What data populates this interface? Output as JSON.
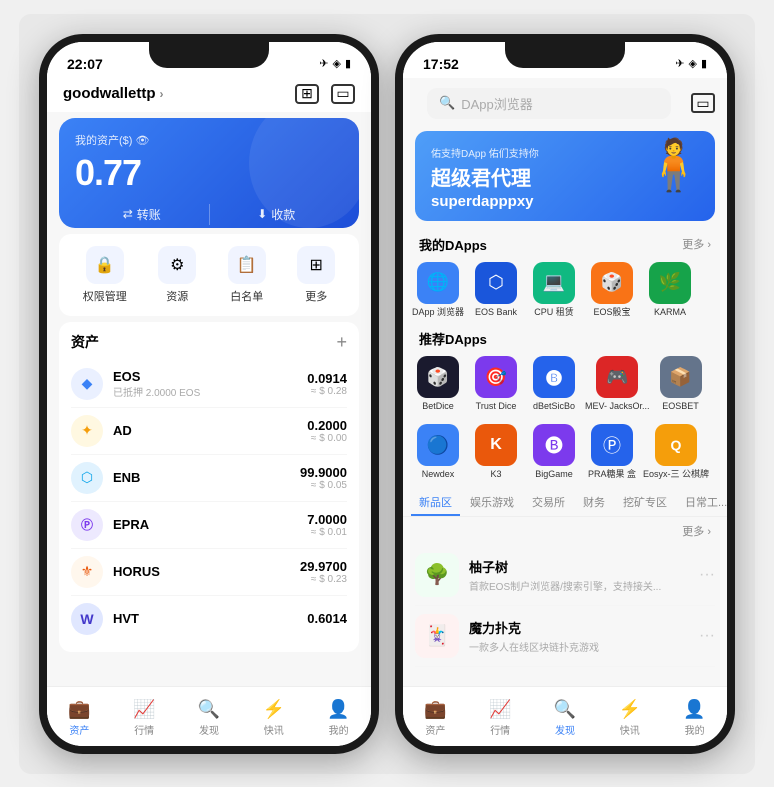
{
  "phone1": {
    "status": {
      "time": "22:07",
      "icons": "✈ ◈ 🔋"
    },
    "header": {
      "wallet_name": "goodwallettp",
      "chevron": "›"
    },
    "balance_card": {
      "label": "我的资产($) 👁",
      "amount": "0.77",
      "btn_transfer": "转账",
      "btn_receive": "收款"
    },
    "quick_actions": [
      {
        "icon": "🔒",
        "label": "权限管理"
      },
      {
        "icon": "⚙",
        "label": "资源"
      },
      {
        "icon": "📋",
        "label": "白名单"
      },
      {
        "icon": "⊞",
        "label": "更多"
      }
    ],
    "asset_section": {
      "title": "资产",
      "add": "+",
      "items": [
        {
          "icon": "◆",
          "icon_bg": "#eee",
          "name": "EOS",
          "sub": "已抵押 2.0000 EOS",
          "amount": "0.0914",
          "usd": "≈ $ 0.28"
        },
        {
          "icon": "✦",
          "icon_bg": "#f0f0f0",
          "name": "AD",
          "sub": "",
          "amount": "0.2000",
          "usd": "≈ $ 0.00"
        },
        {
          "icon": "⬡",
          "icon_bg": "#e8f4ff",
          "name": "ENB",
          "sub": "",
          "amount": "99.9000",
          "usd": "≈ $ 0.05"
        },
        {
          "icon": "Ⓟ",
          "icon_bg": "#e8f0ff",
          "name": "EPRA",
          "sub": "",
          "amount": "7.0000",
          "usd": "≈ $ 0.01"
        },
        {
          "icon": "⚜",
          "icon_bg": "#fff3e0",
          "name": "HORUS",
          "sub": "",
          "amount": "29.9700",
          "usd": "≈ $ 0.23"
        },
        {
          "icon": "W",
          "icon_bg": "#e8f0ff",
          "name": "HVT",
          "sub": "",
          "amount": "0.6014",
          "usd": ""
        }
      ]
    },
    "bottom_nav": [
      {
        "icon": "💼",
        "label": "资产",
        "active": true
      },
      {
        "icon": "📈",
        "label": "行情",
        "active": false
      },
      {
        "icon": "🔍",
        "label": "发现",
        "active": false
      },
      {
        "icon": "⚡",
        "label": "快讯",
        "active": false
      },
      {
        "icon": "👤",
        "label": "我的",
        "active": false
      }
    ]
  },
  "phone2": {
    "status": {
      "time": "17:52",
      "icons": "✈ ◈ 🔋"
    },
    "search_placeholder": "DApp浏览器",
    "banner": {
      "sub": "佑支持DApp 佑们支持你",
      "title": "超级君代理",
      "title2": "superdapppxy",
      "char": "🧍"
    },
    "my_dapps": {
      "title": "我的DApps",
      "more": "更多 ›",
      "items": [
        {
          "icon": "🌐",
          "bg": "#3b82f6",
          "label": "DApp\n浏览器"
        },
        {
          "icon": "⬡",
          "bg": "#1a56db",
          "label": "EOS Bank"
        },
        {
          "icon": "💻",
          "bg": "#10b981",
          "label": "CPU 租赁"
        },
        {
          "icon": "🎲",
          "bg": "#f97316",
          "label": "EOS骰宝"
        },
        {
          "icon": "🌿",
          "bg": "#16a34a",
          "label": "KARMA"
        }
      ]
    },
    "recommended_dapps": {
      "title": "推荐DApps",
      "items": [
        {
          "icon": "🎲",
          "bg": "#1a1a2e",
          "label": "BetDice"
        },
        {
          "icon": "🎯",
          "bg": "#7c3aed",
          "label": "Trust Dice"
        },
        {
          "icon": "🅑",
          "bg": "#2563eb",
          "label": "dBetSicBo"
        },
        {
          "icon": "🎮",
          "bg": "#dc2626",
          "label": "MEV-\nJacksOr..."
        },
        {
          "icon": "📦",
          "bg": "#64748b",
          "label": "EOSBET"
        },
        {
          "icon": "🔵",
          "bg": "#3b82f6",
          "label": "Newdex"
        },
        {
          "icon": "K",
          "bg": "#ea580c",
          "label": "K3"
        },
        {
          "icon": "🅑",
          "bg": "#7c3aed",
          "label": "BigGame"
        },
        {
          "icon": "Ⓟ",
          "bg": "#2563eb",
          "label": "PRA糖果\n盒"
        },
        {
          "icon": "Q",
          "bg": "#f59e0b",
          "label": "Eosyx-三\n公棋牌"
        }
      ]
    },
    "tabs": [
      {
        "label": "新品区",
        "active": true
      },
      {
        "label": "娱乐游戏",
        "active": false
      },
      {
        "label": "交易所",
        "active": false
      },
      {
        "label": "财务",
        "active": false
      },
      {
        "label": "挖矿专区",
        "active": false
      },
      {
        "label": "日常工...",
        "active": false
      }
    ],
    "new_apps": [
      {
        "icon": "🌳",
        "bg": "#f0fdf4",
        "name": "柚子树",
        "desc": "首款EOS制户浏览器/搜索引擎，支持接关..."
      },
      {
        "icon": "🃏",
        "bg": "#fef2f2",
        "name": "魔力扑克",
        "desc": "一款多人在线区块链扑克游戏"
      }
    ],
    "new_more": "更多 ›",
    "bottom_nav": [
      {
        "icon": "💼",
        "label": "资产",
        "active": false
      },
      {
        "icon": "📈",
        "label": "行情",
        "active": false
      },
      {
        "icon": "🔍",
        "label": "发现",
        "active": true
      },
      {
        "icon": "⚡",
        "label": "快讯",
        "active": false
      },
      {
        "icon": "👤",
        "label": "我的",
        "active": false
      }
    ]
  }
}
